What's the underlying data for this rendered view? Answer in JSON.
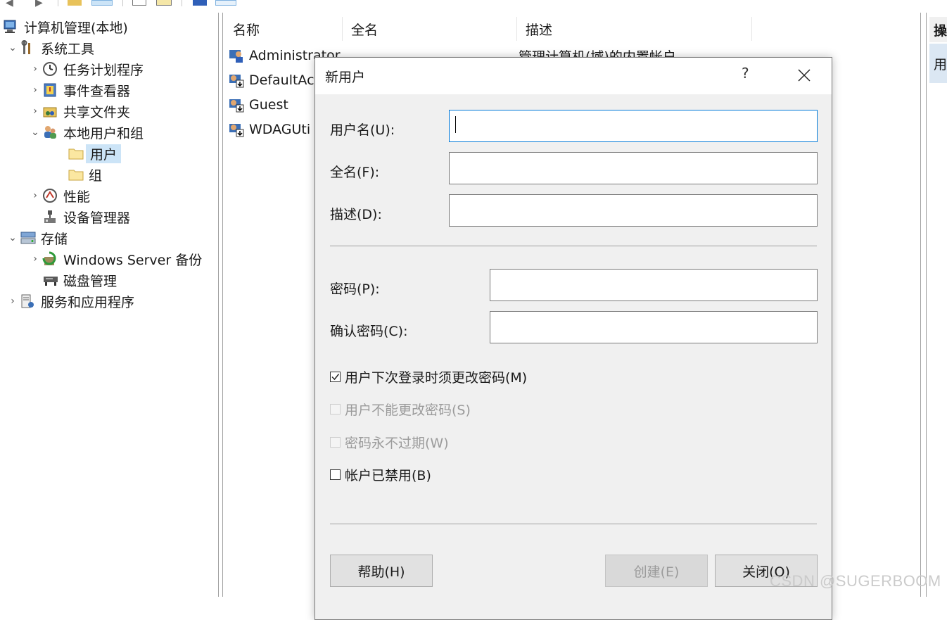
{
  "tree": {
    "items": [
      {
        "label": "计算机管理(本地)"
      },
      {
        "label": "系统工具"
      },
      {
        "label": "任务计划程序"
      },
      {
        "label": "事件查看器"
      },
      {
        "label": "共享文件夹"
      },
      {
        "label": "本地用户和组"
      },
      {
        "label": "用户"
      },
      {
        "label": "组"
      },
      {
        "label": "性能"
      },
      {
        "label": "设备管理器"
      },
      {
        "label": "存储"
      },
      {
        "label": "Windows Server 备份"
      },
      {
        "label": "磁盘管理"
      },
      {
        "label": "服务和应用程序"
      }
    ]
  },
  "list": {
    "columns": [
      "名称",
      "全名",
      "描述"
    ],
    "rows": [
      {
        "name": "Administrator",
        "description": "管理计算机(域)的内置帐户"
      },
      {
        "name": "DefaultAc"
      },
      {
        "name": "Guest"
      },
      {
        "name": "WDAGUti"
      }
    ]
  },
  "actions": {
    "header": "操",
    "item": "用"
  },
  "dialog": {
    "title": "新用户",
    "help_glyph": "?",
    "username_label": "用户名(U):",
    "username_value": "",
    "fullname_label": "全名(F):",
    "fullname_value": "",
    "description_label": "描述(D):",
    "description_value": "",
    "password_label": "密码(P):",
    "confirm_label": "确认密码(C):",
    "checkboxes": [
      {
        "label": "用户下次登录时须更改密码(M)",
        "checked": true,
        "enabled": true
      },
      {
        "label": "用户不能更改密码(S)",
        "checked": false,
        "enabled": false
      },
      {
        "label": "密码永不过期(W)",
        "checked": false,
        "enabled": false
      },
      {
        "label": "帐户已禁用(B)",
        "checked": false,
        "enabled": true
      }
    ],
    "help_button": "帮助(H)",
    "create_button": "创建(E)",
    "close_button": "关闭(O)"
  },
  "watermark": "CSDN @SUGERBOOM",
  "colors": {
    "selection": "#cce4f7",
    "focus_border": "#0078d7",
    "dialog_bg": "#f0f0f0"
  }
}
